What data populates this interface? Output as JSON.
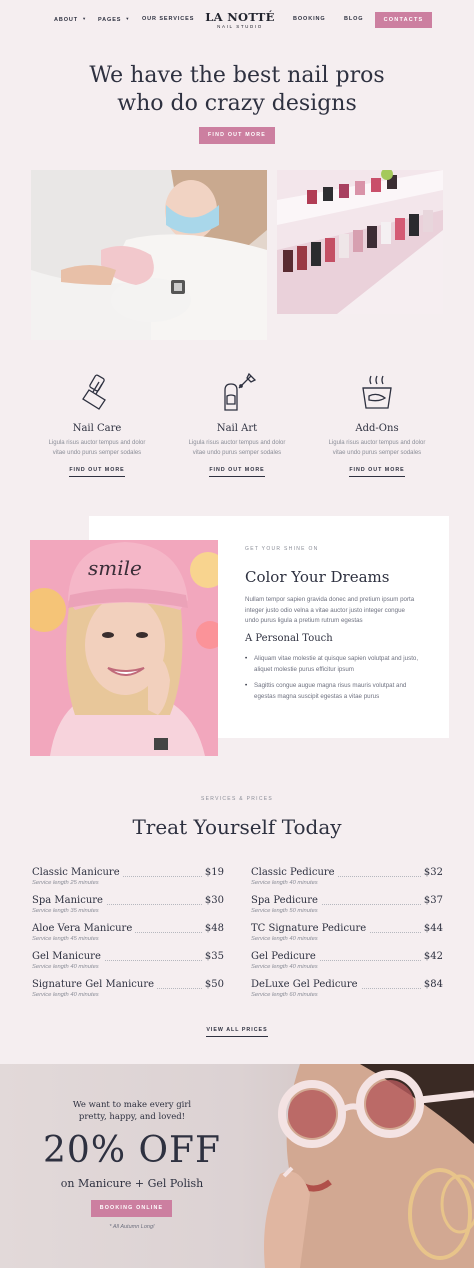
{
  "nav": {
    "about": "ABOUT",
    "pages": "PAGES",
    "services": "OUR SERVICES",
    "booking": "BOOKING",
    "blog": "BLOG",
    "contacts": "CONTACTS",
    "caret_icon": "chevron-down-icon"
  },
  "logo": {
    "name": "LA NOTTÉ",
    "tagline": "NAIL STUDIO"
  },
  "hero": {
    "line1": "We have the best nail pros",
    "line2": "who do crazy designs",
    "button": "FIND OUT MORE"
  },
  "services": [
    {
      "icon": "nail-polish-bottle-icon",
      "title": "Nail Care",
      "text1": "Ligula risus auctor tempus and dolor",
      "text2": "vitae undo purus semper sodales",
      "link": "FIND OUT MORE"
    },
    {
      "icon": "nail-art-brush-icon",
      "title": "Nail Art",
      "text1": "Ligula risus auctor tempus and dolor",
      "text2": "vitae undo purus semper sodales",
      "link": "FIND OUT MORE"
    },
    {
      "icon": "nail-soak-bowl-icon",
      "title": "Add-Ons",
      "text1": "Ligula risus auctor tempus and dolor",
      "text2": "vitae undo purus semper sodales",
      "link": "FIND OUT MORE"
    }
  ],
  "feature": {
    "eyebrow": "GET YOUR SHINE ON",
    "title": "Color Your Dreams",
    "text": "Nullam tempor sapien gravida donec and pretium ipsum porta integer justo odio velna a vitae auctor justo integer congue undo purus ligula a pretium rutrum egestas",
    "subtitle": "A Personal Touch",
    "bullets": [
      "Aliquam vitae molestie at quisque sapien volutpat and justo, aliquet molestie purus efficitur ipsum",
      "Sagittis congue augue magna risus mauris volutpat and egestas magna suscipit egestas a vitae purus"
    ],
    "hat_text": "smile"
  },
  "prices": {
    "eyebrow": "SERVICES & PRICES",
    "title": "Treat Yourself Today",
    "left": [
      {
        "name": "Classic Manicure",
        "price": "$19",
        "length": "Service length 25 minutes"
      },
      {
        "name": "Spa Manicure",
        "price": "$30",
        "length": "Service length 35 minutes"
      },
      {
        "name": "Aloe Vera Manicure",
        "price": "$48",
        "length": "Service length 45 minutes"
      },
      {
        "name": "Gel Manicure",
        "price": "$35",
        "length": "Service length 40 minutes"
      },
      {
        "name": "Signature Gel Manicure",
        "price": "$50",
        "length": "Service length 40 minutes"
      }
    ],
    "right": [
      {
        "name": "Classic Pedicure",
        "price": "$32",
        "length": "Service length 40 minutes"
      },
      {
        "name": "Spa Pedicure",
        "price": "$37",
        "length": "Service length 50 minutes"
      },
      {
        "name": "TC Signature Pedicure",
        "price": "$44",
        "length": "Service length 40 minutes"
      },
      {
        "name": "Gel Pedicure",
        "price": "$42",
        "length": "Service length 40 minutes"
      },
      {
        "name": "DeLuxe Gel Pedicure",
        "price": "$84",
        "length": "Service length 60 minutes"
      }
    ],
    "view_all": "VIEW ALL PRICES"
  },
  "promo": {
    "line1": "We want to make every girl",
    "line2": "pretty, happy, and loved!",
    "discount": "20% OFF",
    "subtitle": "on Manicure + Gel Polish",
    "button": "BOOKING ONLINE",
    "note": "* All Autumn Long!"
  },
  "colors": {
    "accent": "#cc7fa0",
    "background": "#f5eef0",
    "text": "#2e3140"
  }
}
